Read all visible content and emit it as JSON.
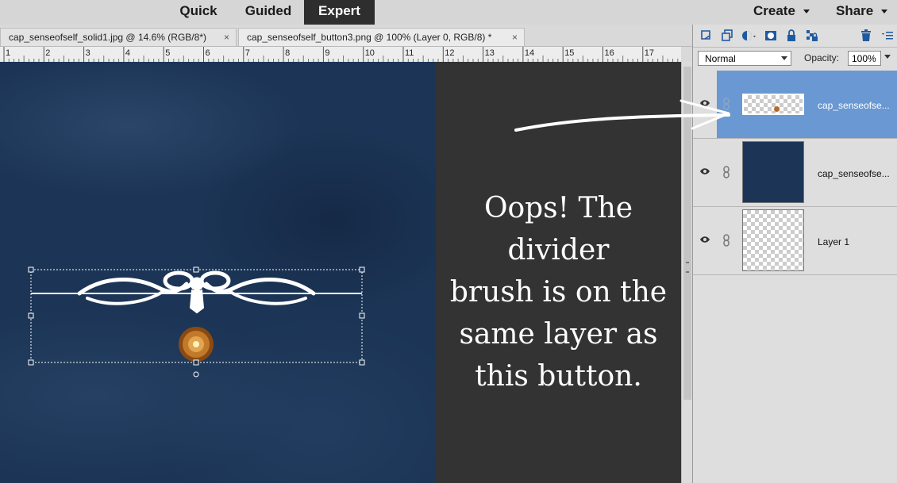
{
  "modes": [
    {
      "label": "Quick",
      "active": false
    },
    {
      "label": "Guided",
      "active": false
    },
    {
      "label": "Expert",
      "active": true
    }
  ],
  "top_right": {
    "create_label": "Create",
    "share_label": "Share"
  },
  "document_tabs": [
    {
      "label": "cap_senseofself_solid1.jpg @ 14.6% (RGB/8*)",
      "close": "×"
    },
    {
      "label": "cap_senseofself_button3.png @ 100% (Layer 0, RGB/8) *",
      "close": "×"
    }
  ],
  "ruler": {
    "numbers": [
      "1",
      "2",
      "3",
      "4",
      "5",
      "6",
      "7",
      "8",
      "9",
      "10",
      "11",
      "12",
      "13",
      "14",
      "15",
      "16",
      "17",
      "1"
    ]
  },
  "callout": {
    "lines": [
      "Oops! The divider",
      "brush is on the",
      "same layer as",
      "this button."
    ]
  },
  "layers_panel": {
    "blend_mode": "Normal",
    "opacity_label": "Opacity:",
    "opacity_value": "100%",
    "layers": [
      {
        "name": "cap_senseofse...",
        "selected": true,
        "thumb": "transparent-with-button"
      },
      {
        "name": "cap_senseofse...",
        "selected": false,
        "thumb": "navy-texture"
      },
      {
        "name": "Layer 1",
        "selected": false,
        "thumb": "transparent"
      }
    ]
  },
  "colors": {
    "canvas_navy": "#1c3556",
    "pasteboard": "#333333",
    "selected_layer": "#6a98d2",
    "active_mode": "#2e2e2e"
  },
  "icons": [
    "new-layer-icon",
    "new-group-icon",
    "adjustment-layer-icon",
    "layer-mask-icon",
    "lock-icon",
    "lock-transparency-icon",
    "trash-icon",
    "panel-menu-icon",
    "eye-icon",
    "link-icon"
  ]
}
